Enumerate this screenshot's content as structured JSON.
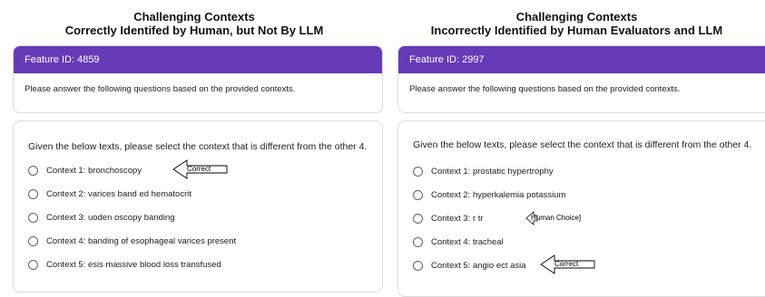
{
  "left": {
    "heading_line1": "Challenging Contexts",
    "heading_line2": "Correctly Identifed by Human, but Not By LLM",
    "feature_id": "Feature ID: 4859",
    "instructions": "Please answer the following questions based on the provided contexts.",
    "question": "Given the below texts, please select the context that is different from the other 4.",
    "options": [
      "Context 1: bronchoscopy",
      "Context 2: varices band ed hematocrit",
      "Context 3: uoden oscopy banding",
      "Context 4: banding of esophageal varices present",
      "Context 5: esis massive blood loss transfused"
    ],
    "annotation_correct": "Correct"
  },
  "right": {
    "heading_line1": "Challenging Contexts",
    "heading_line2": "Incorrectly Identified by Human Evaluators and LLM",
    "feature_id": "Feature ID: 2997",
    "instructions": "Please answer the following questions based on the provided contexts.",
    "question": "Given the below texts, please select the context that is different from the other 4.",
    "options": [
      "Context 1: prostatic hypertrophy",
      "Context 2: hyperkalemia potassium",
      "Context 3: r tr",
      "Context 4: tracheal",
      "Context 5: angio ect asia"
    ],
    "annotation_human": "Human Choice]",
    "annotation_correct": "Correct"
  },
  "colors": {
    "header_purple": "#673ab7",
    "frame_background": "#efebf7",
    "radio_border": "#5f6368"
  },
  "icons": [
    "radio-unselected",
    "left-arrow-outline"
  ]
}
